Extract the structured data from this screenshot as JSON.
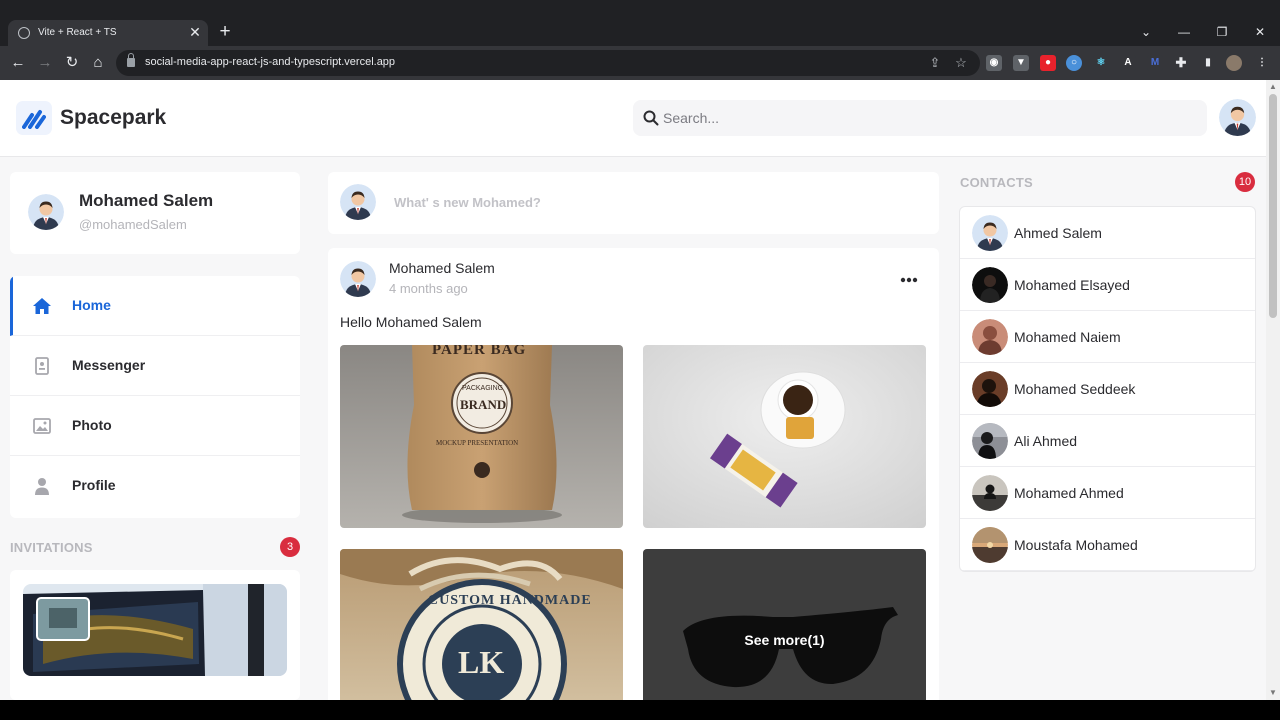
{
  "browser": {
    "tab_title": "Vite + React + TS",
    "tab_close": "✕",
    "new_tab": "+",
    "url": "social-media-app-react-js-and-typescript.vercel.app",
    "window_controls": [
      "⌄",
      "—",
      "❐",
      "✕"
    ]
  },
  "header": {
    "brand": "Spacepark",
    "search_placeholder": "Search..."
  },
  "profile": {
    "name": "Mohamed Salem",
    "handle": "@mohamedSalem"
  },
  "nav": {
    "items": [
      {
        "label": "Home",
        "icon": "home-icon",
        "active": true
      },
      {
        "label": "Messenger",
        "icon": "messenger-icon",
        "active": false
      },
      {
        "label": "Photo",
        "icon": "photo-icon",
        "active": false
      },
      {
        "label": "Profile",
        "icon": "profile-icon",
        "active": false
      }
    ]
  },
  "invitations": {
    "title": "INVITATIONS",
    "count": "3"
  },
  "composer": {
    "placeholder": "What' s new Mohamed?"
  },
  "post": {
    "author": "Mohamed Salem",
    "time": "4 months ago",
    "text": "Hello Mohamed Salem",
    "photos": [
      "paper-bag-photo",
      "coffee-cup-photo",
      "custom-handmade-badge-photo",
      "sunglasses-photo"
    ],
    "bag_label_top": "PAPER BAG",
    "bag_label_brand": "BRAND",
    "bag_label_packaging": "PACKAGING",
    "bag_label_mockup": "MOCKUP PRESENTATION",
    "badge_label_top": "CUSTOM HANDMADE",
    "badge_label_center": "LK",
    "see_more": "See more(1)"
  },
  "contacts": {
    "title": "CONTACTS",
    "count": "10",
    "items": [
      {
        "name": "Ahmed Salem"
      },
      {
        "name": "Mohamed Elsayed"
      },
      {
        "name": "Mohamed Naiem"
      },
      {
        "name": "Mohamed Seddeek"
      },
      {
        "name": "Ali Ahmed"
      },
      {
        "name": "Mohamed Ahmed"
      },
      {
        "name": "Moustafa Mohamed"
      }
    ]
  },
  "colors": {
    "accent": "#1a66d9",
    "badge": "#d92d3f",
    "text": "#2b2b2f",
    "muted": "#b4b4b9"
  }
}
